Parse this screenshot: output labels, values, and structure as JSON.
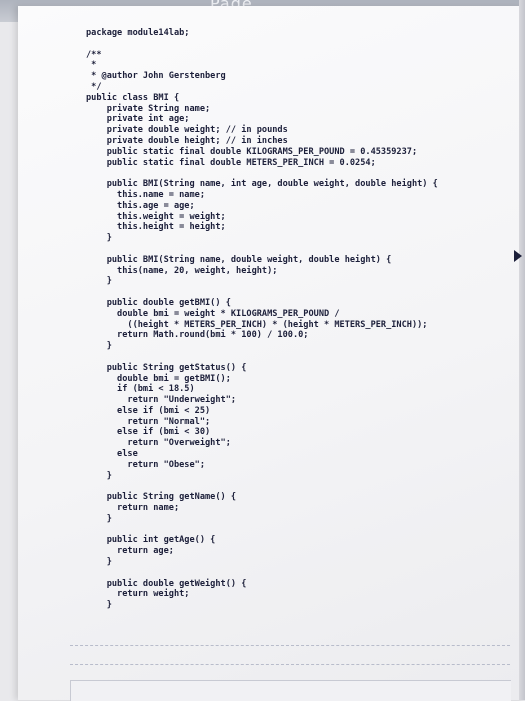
{
  "header_fragment": "Page",
  "code_lines": [
    "package module14lab;",
    "",
    "/**",
    " *",
    " * @author John Gerstenberg",
    " */",
    "public class BMI {",
    "    private String name;",
    "    private int age;",
    "    private double weight; // in pounds",
    "    private double height; // in inches",
    "    public static final double KILOGRAMS_PER_POUND = 0.45359237;",
    "    public static final double METERS_PER_INCH = 0.0254;",
    "",
    "    public BMI(String name, int age, double weight, double height) {",
    "      this.name = name;",
    "      this.age = age;",
    "      this.weight = weight;",
    "      this.height = height;",
    "    }",
    "",
    "    public BMI(String name, double weight, double height) {",
    "      this(name, 20, weight, height);",
    "    }",
    "",
    "    public double getBMI() {",
    "      double bmi = weight * KILOGRAMS_PER_POUND /",
    "        ((height * METERS_PER_INCH) * (height * METERS_PER_INCH));",
    "      return Math.round(bmi * 100) / 100.0;",
    "    }",
    "",
    "    public String getStatus() {",
    "      double bmi = getBMI();",
    "      if (bmi < 18.5)",
    "        return \"Underweight\";",
    "      else if (bmi < 25)",
    "        return \"Normal\";",
    "      else if (bmi < 30)",
    "        return \"Overweight\";",
    "      else",
    "        return \"Obese\";",
    "    }",
    "",
    "    public String getName() {",
    "      return name;",
    "    }",
    "",
    "    public int getAge() {",
    "      return age;",
    "    }",
    "",
    "    public double getWeight() {",
    "      return weight;",
    "    }"
  ]
}
